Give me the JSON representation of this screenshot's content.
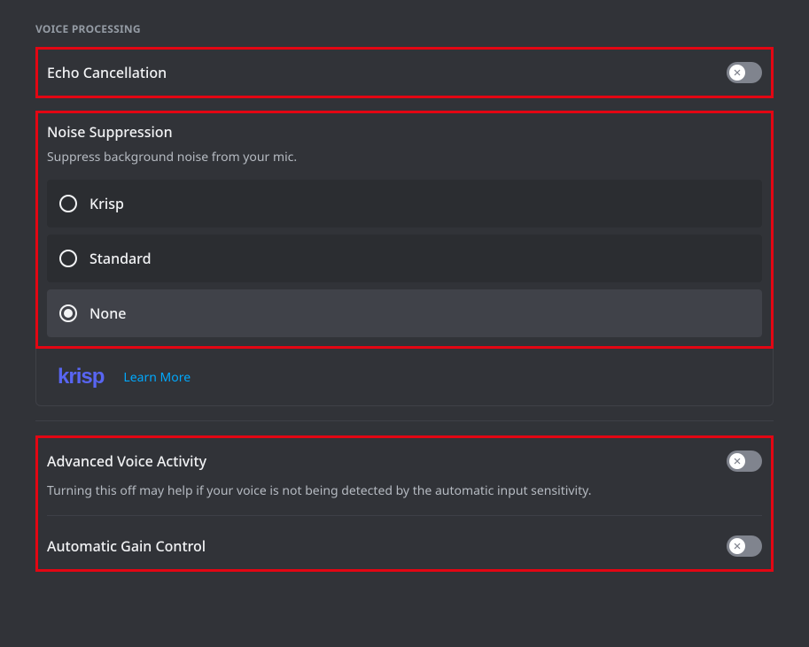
{
  "section": {
    "header": "VOICE PROCESSING"
  },
  "echo": {
    "label": "Echo Cancellation",
    "toggled": false
  },
  "noise": {
    "label": "Noise Suppression",
    "subtitle": "Suppress background noise from your mic.",
    "options": {
      "krisp": "Krisp",
      "standard": "Standard",
      "none": "None"
    },
    "selected": "none"
  },
  "krispRow": {
    "logo": "krisp",
    "learnMore": "Learn More"
  },
  "advancedVoice": {
    "label": "Advanced Voice Activity",
    "subtitle": "Turning this off may help if your voice is not being detected by the automatic input sensitivity.",
    "toggled": false
  },
  "agc": {
    "label": "Automatic Gain Control",
    "toggled": false
  }
}
